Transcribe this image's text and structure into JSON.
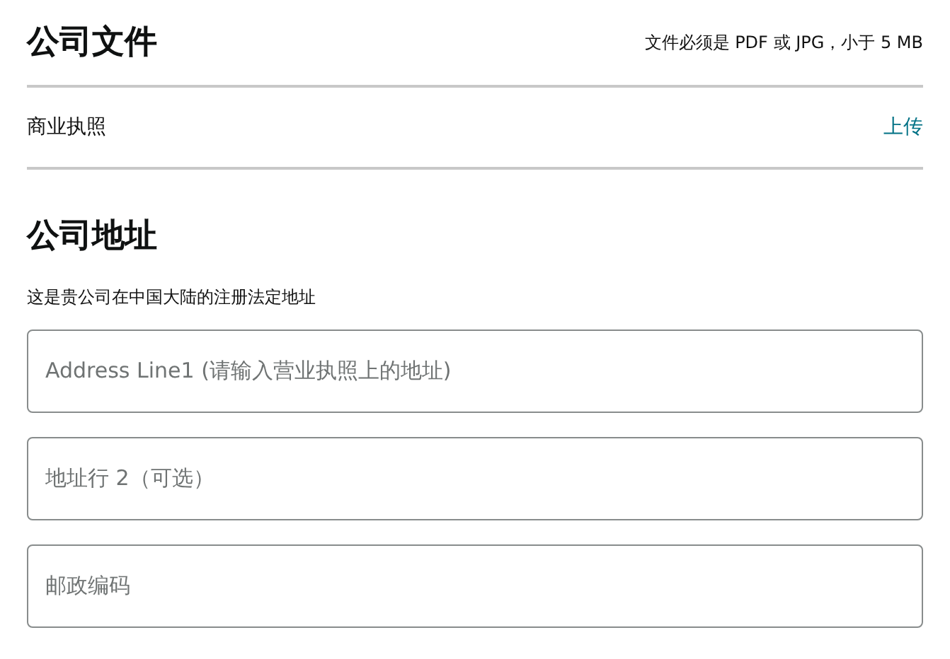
{
  "documents": {
    "title": "公司文件",
    "note": "文件必须是 PDF 或 JPG，小于 5 MB",
    "items": [
      {
        "label": "商业执照",
        "action": "上传"
      }
    ]
  },
  "address": {
    "title": "公司地址",
    "description": "这是贵公司在中国大陆的注册法定地址",
    "fields": [
      {
        "placeholder": "Address Line1 (请输入营业执照上的地址)"
      },
      {
        "placeholder": "地址行 2（可选）"
      },
      {
        "placeholder": "邮政编码"
      }
    ]
  }
}
